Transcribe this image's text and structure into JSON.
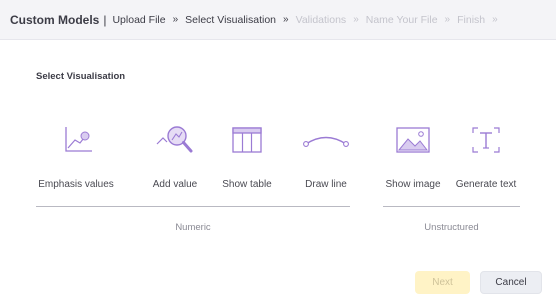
{
  "breadcrumb": {
    "title": "Custom Models",
    "separator": "|",
    "arrow": "»",
    "steps": [
      {
        "label": "Upload File",
        "state": "done"
      },
      {
        "label": "Select Visualisation",
        "state": "current"
      },
      {
        "label": "Validations",
        "state": "future"
      },
      {
        "label": "Name Your File",
        "state": "future"
      },
      {
        "label": "Finish",
        "state": "future"
      }
    ]
  },
  "section_title": "Select Visualisation",
  "options": [
    {
      "label": "Emphasis values",
      "icon": "emphasis-chart-icon",
      "group": "numeric"
    },
    {
      "label": "Add value",
      "icon": "magnifier-chart-icon",
      "group": "numeric"
    },
    {
      "label": "Show table",
      "icon": "table-icon",
      "group": "numeric"
    },
    {
      "label": "Draw line",
      "icon": "curve-line-icon",
      "group": "numeric"
    },
    {
      "label": "Show image",
      "icon": "image-icon",
      "group": "unstructured"
    },
    {
      "label": "Generate text",
      "icon": "text-cursor-icon",
      "group": "unstructured"
    }
  ],
  "groups": {
    "numeric": "Numeric",
    "unstructured": "Unstructured"
  },
  "buttons": {
    "next": "Next",
    "cancel": "Cancel"
  },
  "colors": {
    "accent": "#9b7bd4",
    "accent_light": "#d9ccf0",
    "next_bg": "#fff3c6",
    "topbar_bg": "#f4f4f7"
  }
}
